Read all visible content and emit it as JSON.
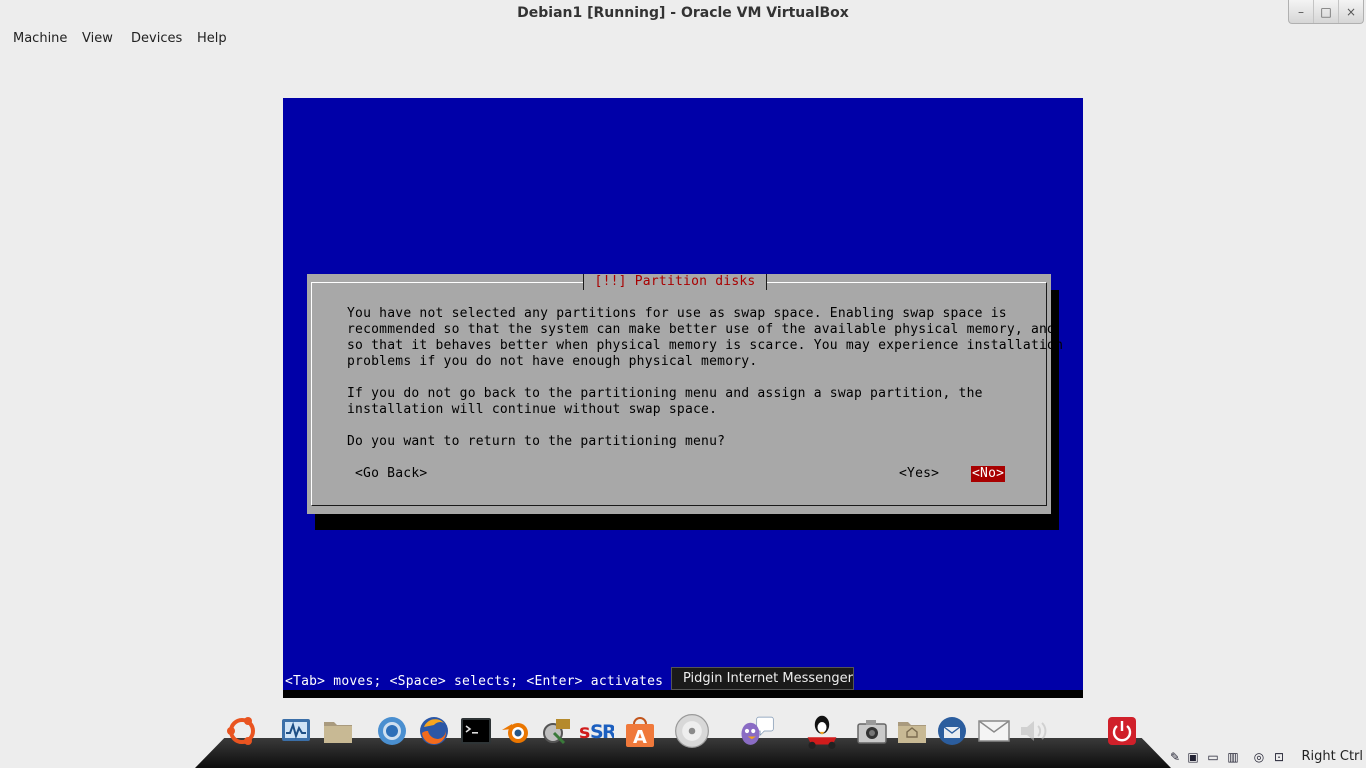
{
  "window": {
    "title": "Debian1 [Running] - Oracle VM VirtualBox"
  },
  "window_controls": {
    "minimize": "–",
    "maximize": "□",
    "close": "×"
  },
  "menu": [
    "Machine",
    "View",
    "Devices",
    "Help"
  ],
  "dialog": {
    "title": "[!!] Partition disks",
    "paragraph1": [
      "You have not selected any partitions for use as swap space. Enabling swap space is",
      "recommended so that the system can make better use of the available physical memory, and",
      "so that it behaves better when physical memory is scarce. You may experience installation",
      "problems if you do not have enough physical memory."
    ],
    "paragraph2": [
      "If you do not go back to the partitioning menu and assign a swap partition, the",
      "installation will continue without swap space."
    ],
    "question": "Do you want to return to the partitioning menu?",
    "go_back": "<Go Back>",
    "yes": "<Yes>",
    "no": "<No>",
    "selected": "no"
  },
  "help_line": "<Tab> moves; <Space> selects; <Enter> activates b",
  "tooltip": "Pidgin Internet Messenger",
  "dock_icons": [
    "ubuntu-icon",
    "system-monitor-icon",
    "files-folder-icon",
    "chromium-icon",
    "firefox-icon",
    "terminal-icon",
    "blender-icon",
    "sysinfo-tool-icon",
    "simplescreenrecorder-icon",
    "software-center-icon",
    "disc-icon",
    "pidgin-icon",
    "supertuxkart-icon",
    "camera-icon",
    "home-folder-icon",
    "thunderbird-icon",
    "mail-icon",
    "volume-icon",
    "power-icon"
  ],
  "host_key": "Right Ctrl",
  "colors": {
    "vm_bg": "#0000a8",
    "dialog_bg": "#a8a8a8",
    "dialog_title": "#a80000",
    "selected_button": "#a80000"
  }
}
